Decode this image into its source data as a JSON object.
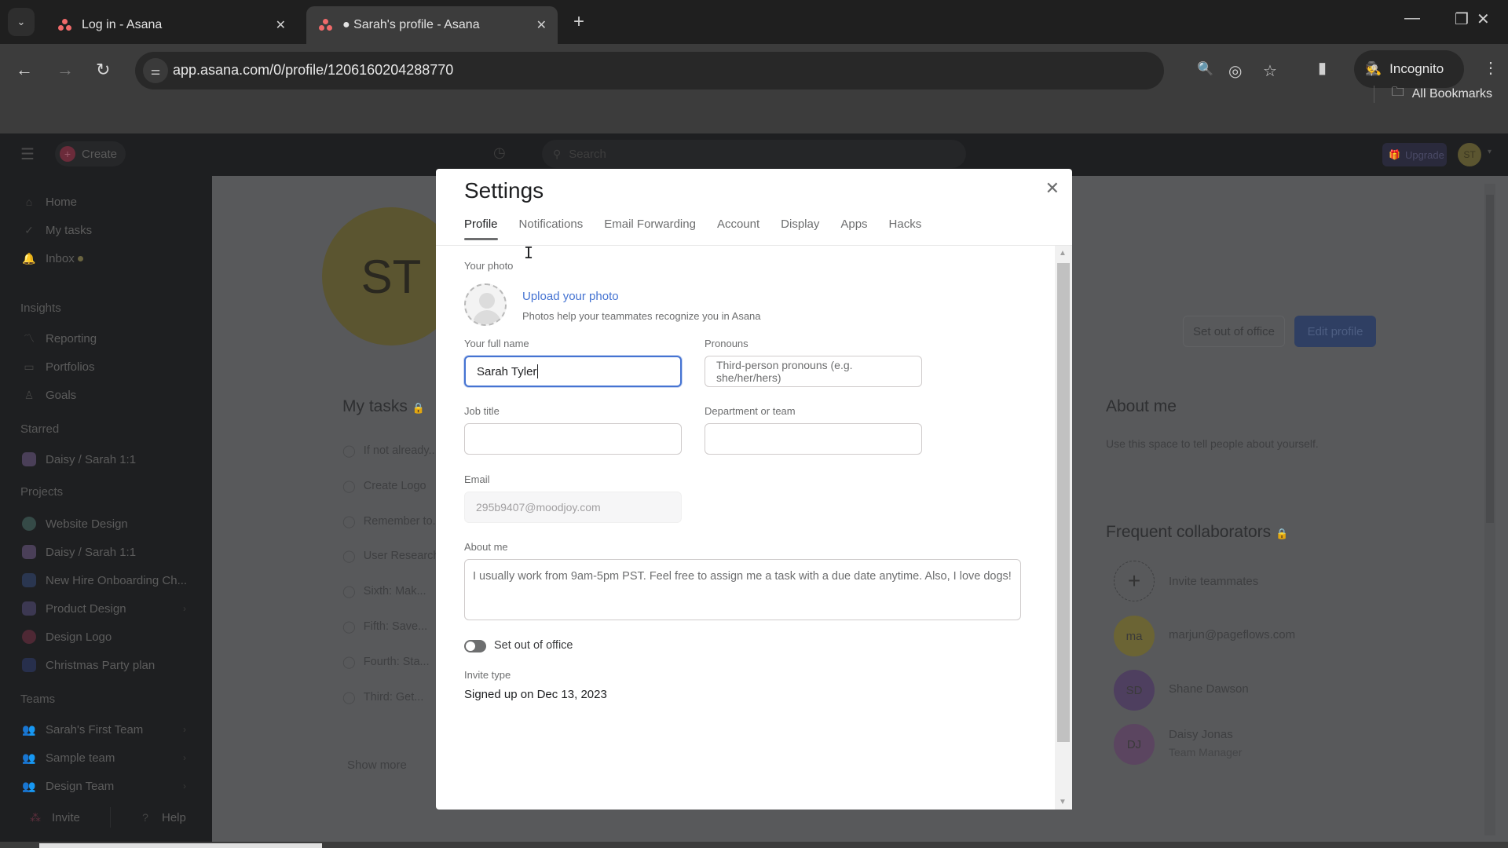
{
  "browser": {
    "tabs": [
      {
        "title": "Log in - Asana",
        "active": false
      },
      {
        "title": "● Sarah's profile - Asana",
        "active": true
      }
    ],
    "url": "app.asana.com/0/profile/1206160204288770",
    "incognito_label": "Incognito",
    "bookmarks_label": "All Bookmarks",
    "icons": {
      "tab_menu": "⌄",
      "close": "✕",
      "new_tab": "+",
      "minimize": "—",
      "restore": "❐",
      "window_close": "✕",
      "back": "←",
      "forward": "→",
      "reload": "↻",
      "site_info": "⚌",
      "zoom": "🔍",
      "eye_off": "◎",
      "star": "☆",
      "side_panel": "▮",
      "menu": "⋮",
      "folder": "🗀"
    }
  },
  "app": {
    "create_label": "Create",
    "search_placeholder": "Search",
    "upgrade_label": "Upgrade",
    "user_initials": "ST",
    "sidebar": {
      "nav": [
        {
          "label": "Home",
          "icon": "⌂"
        },
        {
          "label": "My tasks",
          "icon": "✓"
        },
        {
          "label": "Inbox",
          "icon": "🔔"
        }
      ],
      "insights_heading": "Insights",
      "insights": [
        {
          "label": "Reporting",
          "icon": "〽"
        },
        {
          "label": "Portfolios",
          "icon": "▭"
        },
        {
          "label": "Goals",
          "icon": "♙"
        }
      ],
      "starred_heading": "Starred",
      "starred": [
        {
          "label": "Daisy / Sarah 1:1",
          "color": "#5b4d6b"
        }
      ],
      "projects_heading": "Projects",
      "projects": [
        {
          "label": "Website Design",
          "color": "#3c5753"
        },
        {
          "label": "Daisy / Sarah 1:1",
          "color": "#5b4d6b"
        },
        {
          "label": "New Hire Onboarding Ch...",
          "color": "#2f3f5f"
        },
        {
          "label": "Product Design",
          "color": "#474260"
        },
        {
          "label": "Design Logo",
          "color": "#5e2f3d"
        },
        {
          "label": "Christmas Party plan",
          "color": "#2d3659"
        }
      ],
      "teams_heading": "Teams",
      "teams": [
        {
          "label": "Sarah's First Team"
        },
        {
          "label": "Sample team"
        },
        {
          "label": "Design Team"
        }
      ],
      "invite_label": "Invite",
      "help_label": "Help"
    },
    "profile": {
      "initials": "ST",
      "set_out_of_office": "Set out of office",
      "edit_profile": "Edit profile",
      "my_tasks_heading": "My tasks",
      "tasks": [
        "If not already...",
        "Create Logo",
        "Remember to...",
        "User Research",
        "Sixth: Mak...",
        "Fifth: Save...",
        "Fourth: Sta...",
        "Third: Get..."
      ],
      "show_more": "Show more",
      "about_me_heading": "About me",
      "about_me_placeholder": "Use this space to tell people about yourself.",
      "collaborators_heading": "Frequent collaborators",
      "invite_teammates": "Invite teammates",
      "collaborators": [
        {
          "initials": "ma",
          "name": "marjun@pageflows.com",
          "subtitle": "",
          "color": "#6b6434"
        },
        {
          "initials": "SD",
          "name": "Shane Dawson",
          "subtitle": "",
          "color": "#4e3f5f"
        },
        {
          "initials": "DJ",
          "name": "Daisy Jonas",
          "subtitle": "Team Manager",
          "color": "#5b4560"
        }
      ]
    }
  },
  "settings": {
    "title": "Settings",
    "tabs": [
      "Profile",
      "Notifications",
      "Email Forwarding",
      "Account",
      "Display",
      "Apps",
      "Hacks"
    ],
    "active_tab": "Profile",
    "photo_label": "Your photo",
    "upload_link": "Upload your photo",
    "photo_hint": "Photos help your teammates recognize you in Asana",
    "full_name_label": "Your full name",
    "full_name_value": "Sarah Tyler",
    "pronouns_label": "Pronouns",
    "pronouns_placeholder": "Third-person pronouns (e.g. she/her/hers)",
    "job_title_label": "Job title",
    "job_title_value": "",
    "department_label": "Department or team",
    "department_value": "",
    "email_label": "Email",
    "email_value": "295b9407@moodjoy.com",
    "about_label": "About me",
    "about_value": "I usually work from 9am-5pm PST. Feel free to assign me a task with a due date anytime. Also, I love dogs!",
    "out_of_office_label": "Set out of office",
    "out_of_office_on": false,
    "invite_type_label": "Invite type",
    "invite_type_value": "Signed up on Dec 13, 2023"
  }
}
